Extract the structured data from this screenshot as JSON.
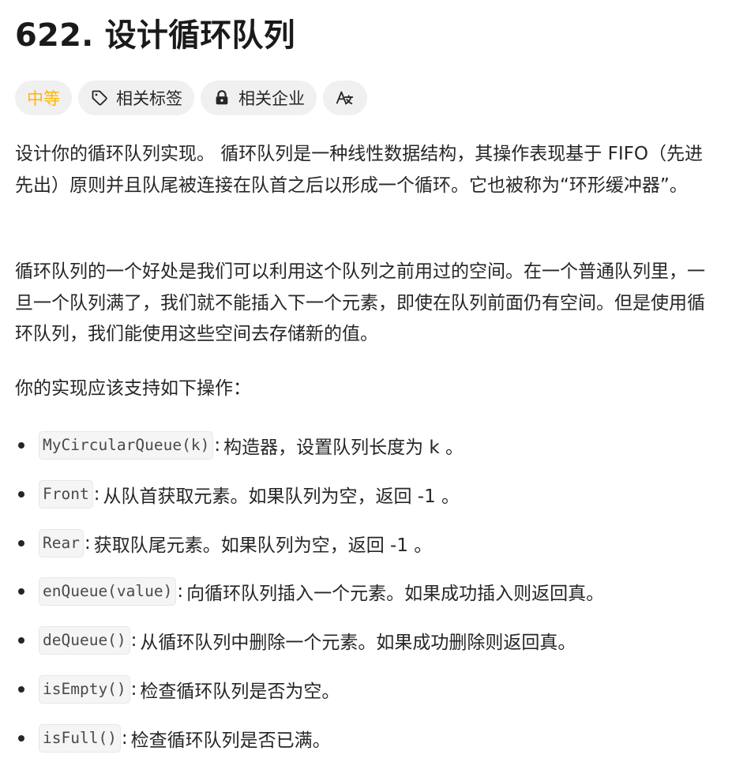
{
  "problem": {
    "title": "622. 设计循环队列"
  },
  "tags": {
    "difficulty": "中等",
    "related_topics": "相关标签",
    "related_companies": "相关企业",
    "translate_icon": "translate-icon"
  },
  "colors": {
    "difficulty_medium": "#ffb700",
    "tag_bg": "#f0f0f0",
    "text": "#262626",
    "code_bg": "#f5f5f5"
  },
  "description": {
    "p1": "设计你的循环队列实现。 循环队列是一种线性数据结构，其操作表现基于 FIFO（先进先出）原则并且队尾被连接在队首之后以形成一个循环。它也被称为“环形缓冲器”。",
    "p2": "循环队列的一个好处是我们可以利用这个队列之前用过的空间。在一个普通队列里，一旦一个队列满了，我们就不能插入下一个元素，即使在队列前面仍有空间。但是使用循环队列，我们能使用这些空间去存储新的值。",
    "p3": "你的实现应该支持如下操作："
  },
  "operations": [
    {
      "code": "MyCircularQueue(k)",
      "text": "构造器，设置队列长度为 k 。"
    },
    {
      "code": "Front",
      "text": "从队首获取元素。如果队列为空，返回 -1 。"
    },
    {
      "code": "Rear",
      "text": "获取队尾元素。如果队列为空，返回 -1 。"
    },
    {
      "code": "enQueue(value)",
      "text": "向循环队列插入一个元素。如果成功插入则返回真。"
    },
    {
      "code": "deQueue()",
      "text": "从循环队列中删除一个元素。如果成功删除则返回真。"
    },
    {
      "code": "isEmpty()",
      "text": "检查循环队列是否为空。"
    },
    {
      "code": "isFull()",
      "text": "检查循环队列是否已满。"
    }
  ],
  "separator": ":"
}
